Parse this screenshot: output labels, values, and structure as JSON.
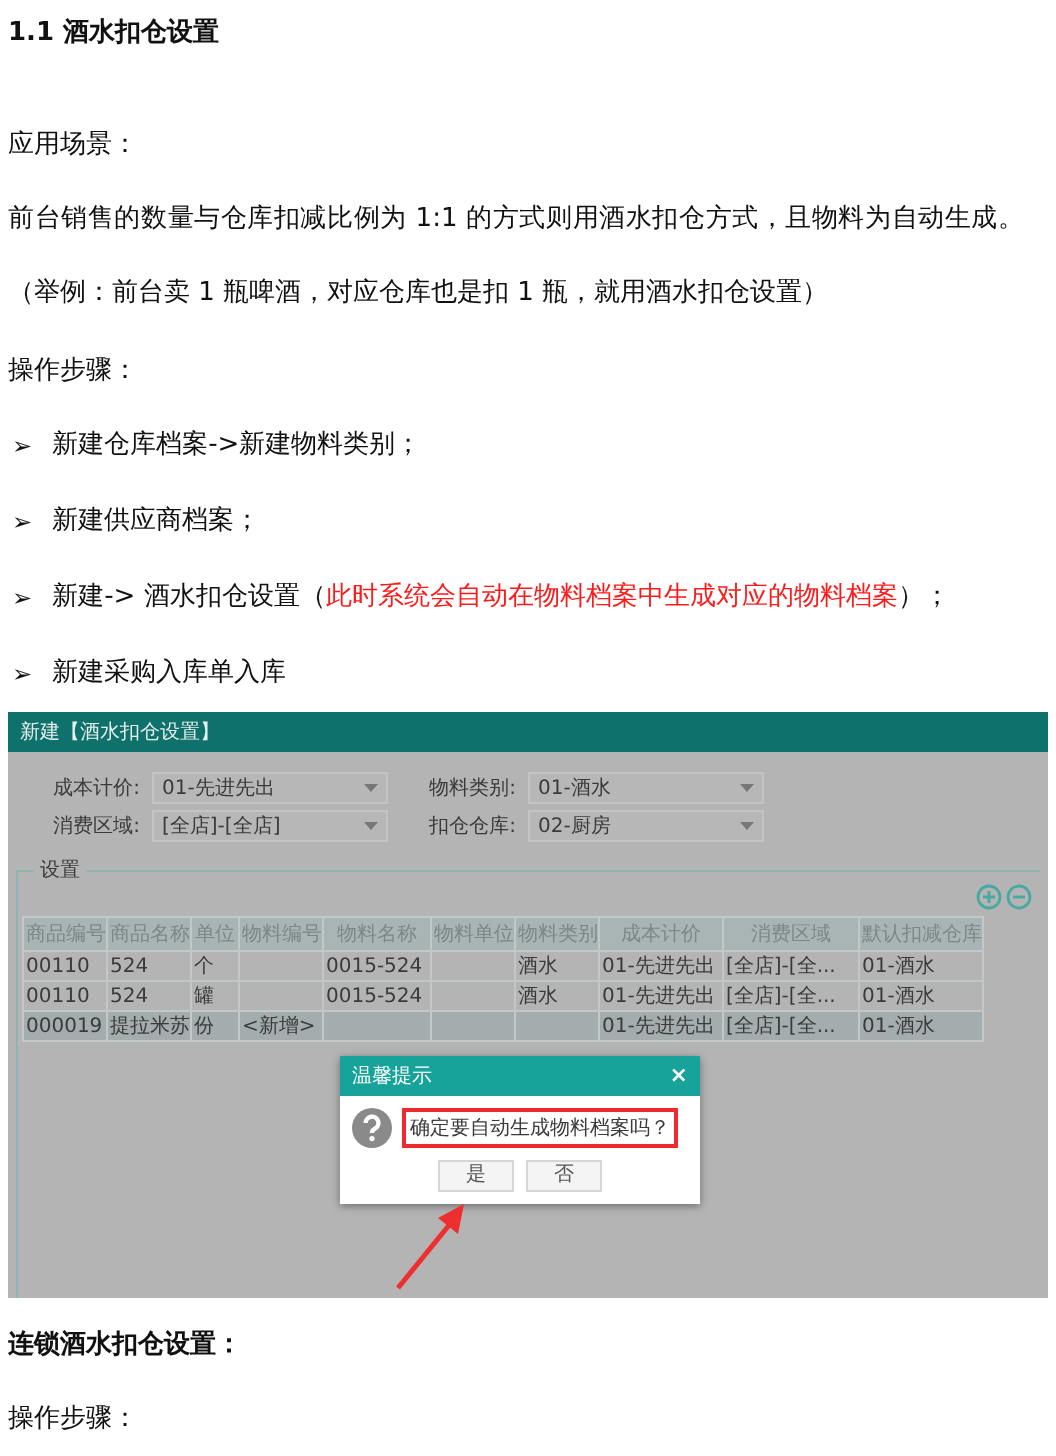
{
  "title": "1.1 酒水扣仓设置",
  "scenario_label": "应用场景：",
  "scenario_text": "前台销售的数量与仓库扣减比例为 1:1 的方式则用酒水扣仓方式，且物料为自动生成。（举例：前台卖 1 瓶啤酒，对应仓库也是扣 1 瓶，就用酒水扣仓设置）",
  "steps_label": "操作步骤：",
  "steps": [
    {
      "marker": "➢",
      "parts": [
        {
          "text": "新建仓库档案->新建物料类别；",
          "highlight": false
        }
      ]
    },
    {
      "marker": "➢",
      "parts": [
        {
          "text": "新建供应商档案；",
          "highlight": false
        }
      ]
    },
    {
      "marker": "➢",
      "parts": [
        {
          "text": "新建-> 酒水扣仓设置（",
          "highlight": false
        },
        {
          "text": "此时系统会自动在物料档案中生成对应的物料档案",
          "highlight": true
        },
        {
          "text": "）；",
          "highlight": false
        }
      ]
    },
    {
      "marker": "➢",
      "parts": [
        {
          "text": "新建采购入库单入库",
          "highlight": false
        }
      ]
    }
  ],
  "screenshot": {
    "title": "新建【酒水扣仓设置】",
    "fields": [
      {
        "label": "成本计价:",
        "value": "01-先进先出"
      },
      {
        "label": "物料类别:",
        "value": "01-酒水"
      },
      {
        "label": "消费区域:",
        "value": "[全店]-[全店]"
      },
      {
        "label": "扣仓仓库:",
        "value": "02-厨房"
      }
    ],
    "legend": "设置",
    "columns": [
      "商品编号",
      "商品名称",
      "单位",
      "物料编号",
      "物料名称",
      "物料单位",
      "物料类别",
      "成本计价",
      "消费区域",
      "默认扣减仓库"
    ],
    "rows": [
      {
        "selected": false,
        "cells": [
          "00110",
          "524",
          "个",
          null,
          "0015-524",
          null,
          "酒水",
          "01-先进先出",
          "[全店]-[全...",
          "01-酒水"
        ]
      },
      {
        "selected": false,
        "cells": [
          "00110",
          "524",
          "罐",
          null,
          "0015-524",
          null,
          "酒水",
          "01-先进先出",
          "[全店]-[全...",
          "01-酒水"
        ]
      },
      {
        "selected": true,
        "cells": [
          "000019",
          "提拉米苏",
          "份",
          "<新增>",
          null,
          null,
          null,
          "01-先进先出",
          "[全店]-[全...",
          "01-酒水"
        ]
      }
    ],
    "dialog": {
      "title": "温馨提示",
      "close": "×",
      "message": "确定要自动生成物料档案吗？",
      "buttons": [
        "是",
        "否"
      ]
    }
  },
  "chain_title": "连锁酒水扣仓设置：",
  "chain_steps_label": "操作步骤："
}
